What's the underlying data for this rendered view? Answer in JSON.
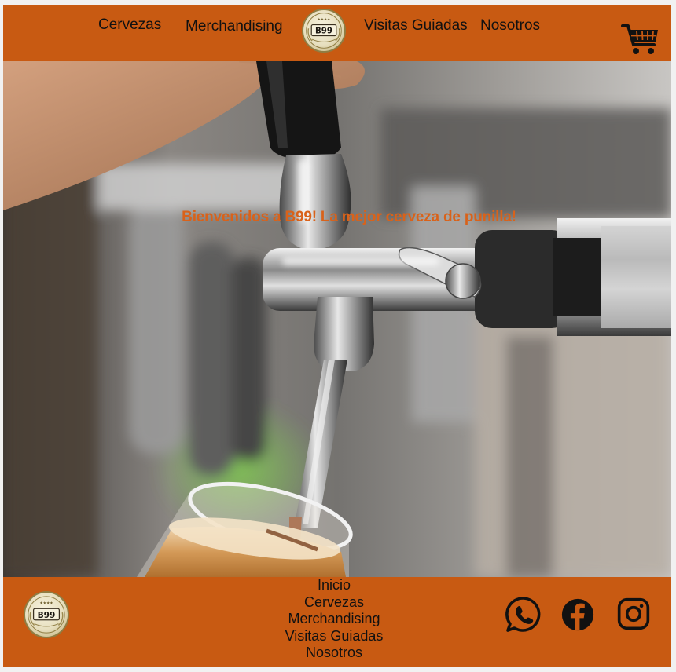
{
  "header": {
    "nav_left": [
      "Cervezas",
      "Merchandising"
    ],
    "nav_right": [
      "Visitas Guiadas",
      "Nosotros"
    ],
    "logo_text": "B99",
    "cart_icon": "shopping-cart-icon"
  },
  "hero": {
    "title": "Bienvenidos a B99! La mejor cerveza de punilla!"
  },
  "footer": {
    "logo_text": "B99",
    "links": [
      "Inicio",
      "Cervezas",
      "Merchandising",
      "Visitas Guiadas",
      "Nosotros"
    ],
    "social_icons": [
      "whatsapp-icon",
      "facebook-icon",
      "instagram-icon"
    ]
  },
  "colors": {
    "brand": "#c85a12",
    "title": "#d9621a",
    "text": "#111111"
  }
}
